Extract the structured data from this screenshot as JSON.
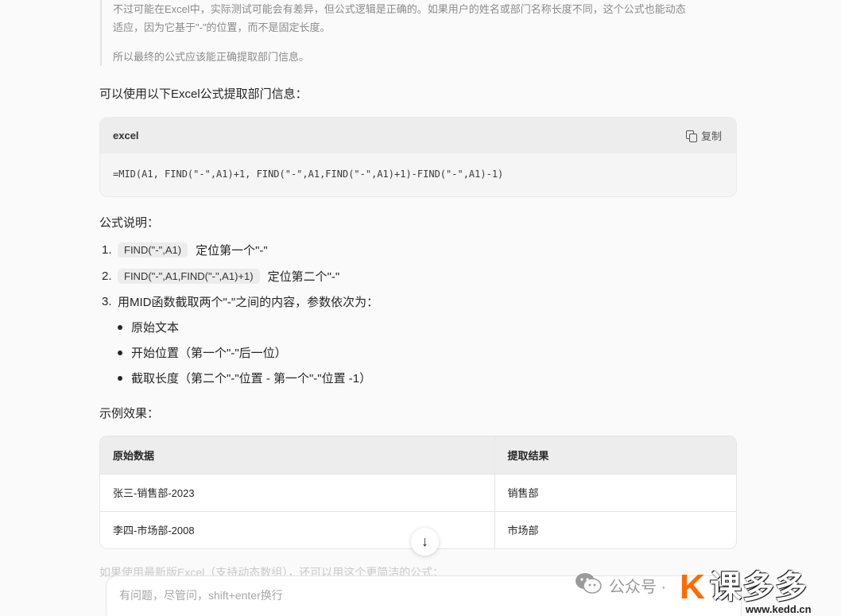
{
  "thinking": {
    "line1": "不过可能在Excel中，实际测试可能会有差异，但公式逻辑是正确的。如果用户的姓名或部门名称长度不同，这个公式也能动态",
    "line2": "适应，因为它基于\"-\"的位置，而不是固定长度。",
    "line3": "所以最终的公式应该能正确提取部门信息。"
  },
  "intro": "可以使用以下Excel公式提取部门信息：",
  "code": {
    "lang": "excel",
    "copy_label": "复制",
    "content": "=MID(A1, FIND(\"-\",A1)+1, FIND(\"-\",A1,FIND(\"-\",A1)+1)-FIND(\"-\",A1)-1)"
  },
  "explain_title": "公式说明：",
  "ordered": [
    {
      "num": "1.",
      "code": "FIND(\"-\",A1)",
      "text": "定位第一个\"-\""
    },
    {
      "num": "2.",
      "code": "FIND(\"-\",A1,FIND(\"-\",A1)+1)",
      "text": "定位第二个\"-\""
    },
    {
      "num": "3.",
      "text": "用MID函数截取两个\"-\"之间的内容，参数依次为："
    }
  ],
  "bullets": [
    "原始文本",
    "开始位置（第一个\"-\"后一位）",
    "截取长度（第二个\"-\"位置 - 第一个\"-\"位置 -1）"
  ],
  "example_title": "示例效果：",
  "table": {
    "headers": [
      "原始数据",
      "提取结果"
    ],
    "rows": [
      [
        "张三-销售部-2023",
        "销售部"
      ],
      [
        "李四-市场部-2008",
        "市场部"
      ]
    ]
  },
  "faded_line": "如果使用最新版Excel（支持动态数组），还可以用这个更简洁的公式：",
  "input_placeholder": "有问题，尽管问，shift+enter换行",
  "watermark": {
    "account": "公众号 ·",
    "brand": "课多多",
    "url": "www.kedd.cn"
  },
  "colors": {
    "accent": "#ff6a00"
  }
}
